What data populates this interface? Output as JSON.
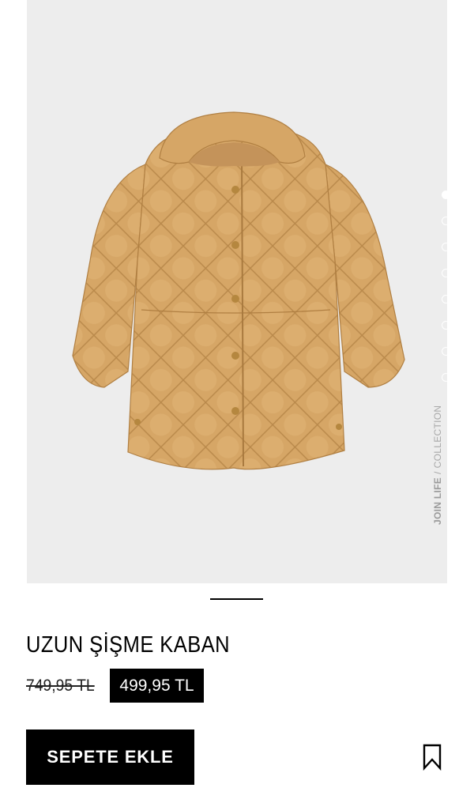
{
  "product": {
    "image_alt": "",
    "gallery_total": 8,
    "gallery_active": 1,
    "collection_label_strong": "JOIN LIFE",
    "collection_label_sep": "/",
    "collection_label_rest": "COLLECTION",
    "name": "UZUN ŞİŞME KABAN",
    "old_price": "749,95 TL",
    "new_price": "499,95 TL",
    "add_to_cart_label": "SEPETE EKLE",
    "bookmark_icon": "bookmark-icon"
  },
  "colors": {
    "image_background": "#ededed",
    "coat": "#d8a868",
    "button_background": "#000000",
    "button_text": "#ffffff"
  }
}
